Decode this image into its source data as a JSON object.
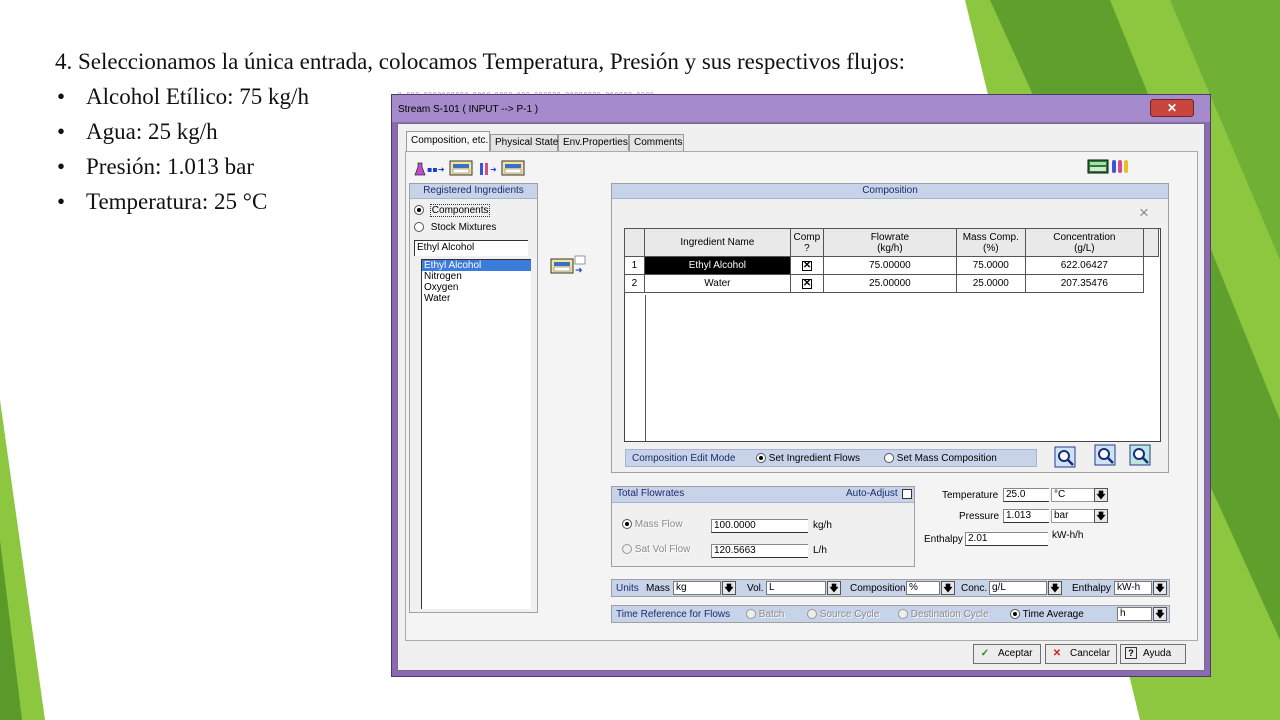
{
  "slide": {
    "heading": "4. Seleccionamos la única entrada, colocamos Temperatura, Presión y sus respectivos flujos:",
    "bullets": [
      "Alcohol Etílico: 75 kg/h",
      "Agua: 25 kg/h",
      "Presión: 1.013 bar",
      "Temperatura: 25 °C"
    ],
    "colors": {
      "accent_green": "#8dc63f",
      "dark_green": "#5a9a2a"
    }
  },
  "dialog": {
    "title": "Stream S-101 ( INPUT --> P-1 )",
    "close_label": "✕",
    "tabs": [
      "Composition, etc.",
      "Physical State",
      "Env.Properties",
      "Comments"
    ],
    "registered": {
      "header": "Registered Ingredients",
      "radio_components": "Components",
      "radio_stock": "Stock Mixtures",
      "selected_text": "Ethyl Alcohol",
      "items": [
        "Ethyl Alcohol",
        "Nitrogen",
        "Oxygen",
        "Water"
      ]
    },
    "composition": {
      "header": "Composition",
      "columns": [
        "Ingredient Name",
        "Comp\n?",
        "Flowrate\n(kg/h)",
        "Mass Comp.\n(%)",
        "Concentration\n(g/L)"
      ],
      "rows": [
        {
          "index": "1",
          "name": "Ethyl Alcohol",
          "comp": "✕",
          "flowrate": "75.00000",
          "mass_comp": "75.0000",
          "concentration": "622.06427"
        },
        {
          "index": "2",
          "name": "Water",
          "comp": "✕",
          "flowrate": "25.00000",
          "mass_comp": "25.0000",
          "concentration": "207.35476"
        }
      ],
      "edit_mode_label": "Composition Edit Mode",
      "edit_mode_flows": "Set Ingredient Flows",
      "edit_mode_mass": "Set Mass Composition"
    },
    "total_flowrates": {
      "header": "Total Flowrates",
      "auto_adjust": "Auto-Adjust",
      "mass_flow_label": "Mass Flow",
      "mass_flow_value": "100.0000",
      "mass_flow_unit": "kg/h",
      "vol_flow_label": "Sat Vol Flow",
      "vol_flow_value": "120.5663",
      "vol_flow_unit": "L/h"
    },
    "state": {
      "temperature_label": "Temperature",
      "temperature_value": "25.0",
      "temperature_unit": "°C",
      "pressure_label": "Pressure",
      "pressure_value": "1.013",
      "pressure_unit": "bar",
      "enthalpy_label": "Enthalpy",
      "enthalpy_value": "2.01",
      "enthalpy_unit": "kW-h/h"
    },
    "units": {
      "label": "Units",
      "mass_label": "Mass",
      "mass_value": "kg",
      "vol_label": "Vol.",
      "vol_value": "L",
      "composition_label": "Composition",
      "composition_value": "%",
      "conc_label": "Conc.",
      "conc_value": "g/L",
      "enthalpy_label": "Enthalpy",
      "enthalpy_value": "kW-h"
    },
    "time_ref": {
      "label": "Time Reference for Flows",
      "batch": "Batch",
      "source": "Source Cycle",
      "destination": "Destination Cycle",
      "average": "Time Average",
      "unit_value": "h"
    },
    "buttons": {
      "ok": "Aceptar",
      "cancel": "Cancelar",
      "help": "Ayuda"
    }
  }
}
